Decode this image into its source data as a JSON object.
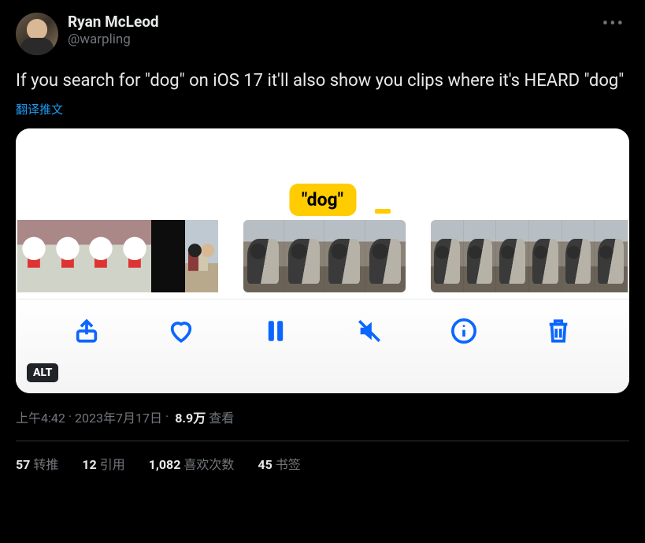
{
  "author": {
    "display_name": "Ryan McLeod",
    "handle": "@warpling"
  },
  "body_text": "If you search for \"dog\" on iOS 17 it'll also show you clips where it's HEARD \"dog\"",
  "translate_label": "翻译推文",
  "media": {
    "caption_tag": "\"dog\"",
    "alt_badge": "ALT"
  },
  "meta": {
    "time": "上午4:42",
    "date": "2023年7月17日",
    "views_count": "8.9万",
    "views_label": "查看",
    "separator": " · "
  },
  "stats": {
    "retweets": {
      "count": "57",
      "label": "转推"
    },
    "quotes": {
      "count": "12",
      "label": "引用"
    },
    "likes": {
      "count": "1,082",
      "label": "喜欢次数"
    },
    "bookmarks": {
      "count": "45",
      "label": "书签"
    }
  },
  "icons": {
    "more": "more-icon",
    "share": "share-icon",
    "heart": "heart-icon",
    "pause": "pause-icon",
    "mute": "mute-icon",
    "info": "info-icon",
    "trash": "trash-icon"
  }
}
